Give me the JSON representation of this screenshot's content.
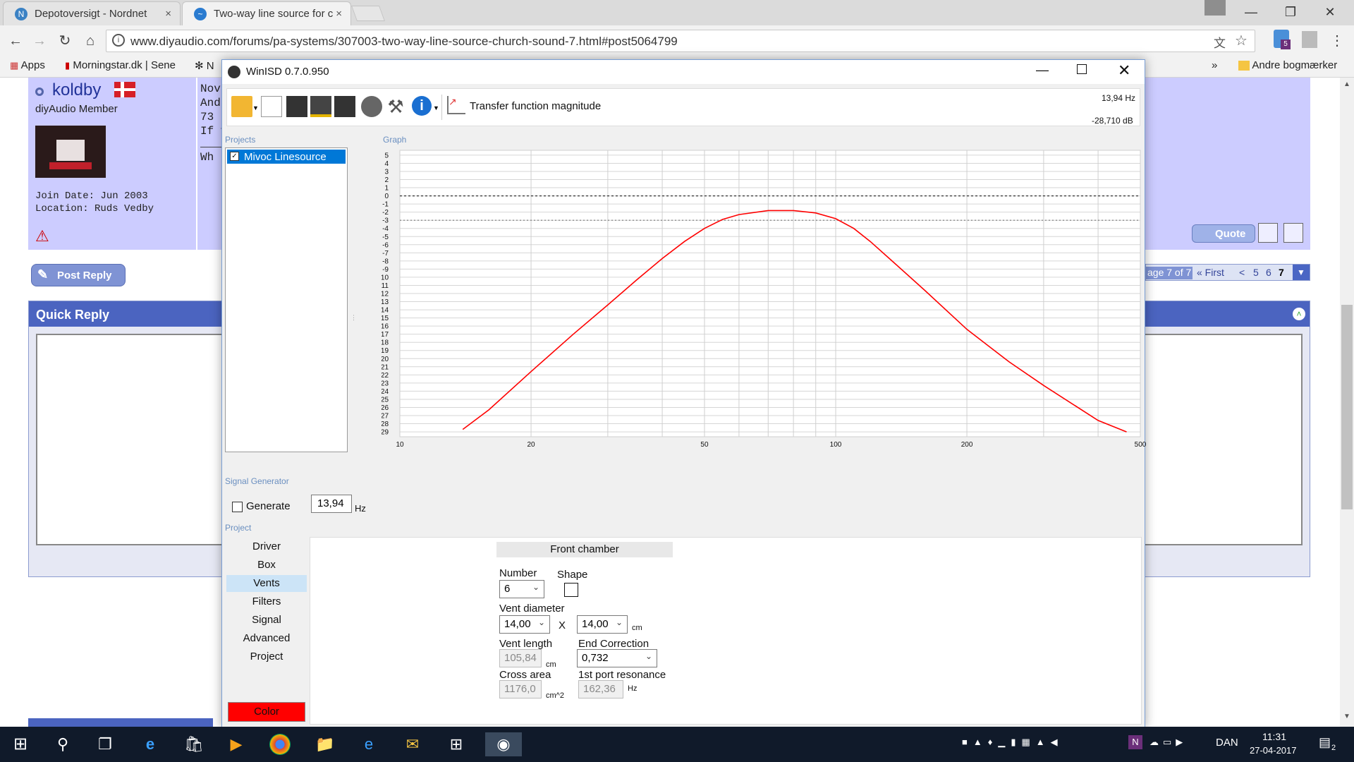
{
  "browser": {
    "tabs": [
      {
        "title": "Depotoversigt - Nordnet",
        "close": "×"
      },
      {
        "title": "Two-way line source for c",
        "close": "×"
      }
    ],
    "url": "www.diyaudio.com/forums/pa-systems/307003-two-way-line-source-church-sound-7.html#post5064799",
    "bookmarks": [
      {
        "label": "Apps"
      },
      {
        "label": "Morningstar.dk | Sene"
      },
      {
        "label": "N"
      },
      {
        "label": "»"
      },
      {
        "label": "Andre bogmærker"
      }
    ],
    "extension_badge": "5"
  },
  "forum": {
    "username": "koldby",
    "member_title": "diyAudio Member",
    "join_date": "Join Date: Jun 2003",
    "location": "Location: Ruds Vedby",
    "post_lines": [
      "Nov",
      "And",
      "73",
      "If y",
      "Wh"
    ],
    "quote_label": "Quote",
    "post_reply_label": "Post Reply",
    "quick_reply_title": "Quick Reply",
    "pagination": {
      "label": "age 7 of 7",
      "first": "« First",
      "prev": "<",
      "pages": [
        "5",
        "6",
        "7"
      ],
      "current": "7"
    }
  },
  "winisd": {
    "title": "WinISD 0.7.0.950",
    "toolbar_label": "Transfer function magnitude",
    "readout_freq": "13,94 Hz",
    "readout_db": "-28,710 dB",
    "sections": {
      "projects": "Projects",
      "graph": "Graph",
      "signal_generator": "Signal Generator",
      "project": "Project"
    },
    "project_item": "Mivoc Linesource",
    "generate_label": "Generate",
    "generate_freq": "13,94",
    "generate_unit": "Hz",
    "nav": [
      "Driver",
      "Box",
      "Vents",
      "Filters",
      "Signal",
      "Advanced",
      "Project"
    ],
    "nav_selected": "Vents",
    "color_button": "Color",
    "color_button_bg": "#ff0000",
    "vents": {
      "header": "Front chamber",
      "number_label": "Number",
      "number_value": "6",
      "shape_label": "Shape",
      "vent_diameter_label": "Vent diameter",
      "diameter_a": "14,00",
      "x_label": "X",
      "diameter_b": "14,00",
      "diameter_unit": "cm",
      "vent_length_label": "Vent length",
      "vent_length_value": "105,84",
      "vent_length_unit": "cm",
      "end_correction_label": "End Correction",
      "end_correction_value": "0,732",
      "cross_area_label": "Cross area",
      "cross_area_value": "1176,0",
      "cross_area_unit": "cm^2",
      "port_resonance_label": "1st port resonance",
      "port_resonance_value": "162,36",
      "port_resonance_unit": "Hz"
    }
  },
  "chart_data": {
    "type": "line",
    "x_scale": "log",
    "xlim": [
      10,
      500
    ],
    "ylim": [
      -29,
      5
    ],
    "x_ticks": [
      "10",
      "20",
      "50",
      "100",
      "200",
      "500"
    ],
    "y_ticks": [
      "5",
      "4",
      "3",
      "2",
      "1",
      "0",
      "-1",
      "-2",
      "-3",
      "-4",
      "-5",
      "-6",
      "-7",
      "-8",
      "-9",
      "-10",
      "-11",
      "-12",
      "-13",
      "-14",
      "-15",
      "-16",
      "-17",
      "-18",
      "-19",
      "-20",
      "-21",
      "-22",
      "-23",
      "-24",
      "-25",
      "-26",
      "-27",
      "-28",
      "-29"
    ],
    "reference_lines": [
      0,
      -3
    ],
    "series_color": "#ff0000",
    "series": [
      {
        "x": [
          13.94,
          16,
          20,
          25,
          30,
          35,
          40,
          45,
          50,
          55,
          60,
          70,
          80,
          90,
          100,
          110,
          120,
          140,
          160,
          200,
          250,
          300,
          400,
          465
        ],
        "y": [
          -28.7,
          -26.3,
          -21.6,
          -17.0,
          -13.4,
          -10.3,
          -7.7,
          -5.6,
          -4.0,
          -2.9,
          -2.3,
          -1.8,
          -1.8,
          -2.1,
          -2.8,
          -4.0,
          -5.6,
          -8.8,
          -11.6,
          -16.4,
          -20.4,
          -23.3,
          -27.6,
          -29.0
        ]
      }
    ]
  },
  "taskbar": {
    "language": "DAN",
    "time": "11:31",
    "date": "27-04-2017",
    "notification_count": "2"
  }
}
